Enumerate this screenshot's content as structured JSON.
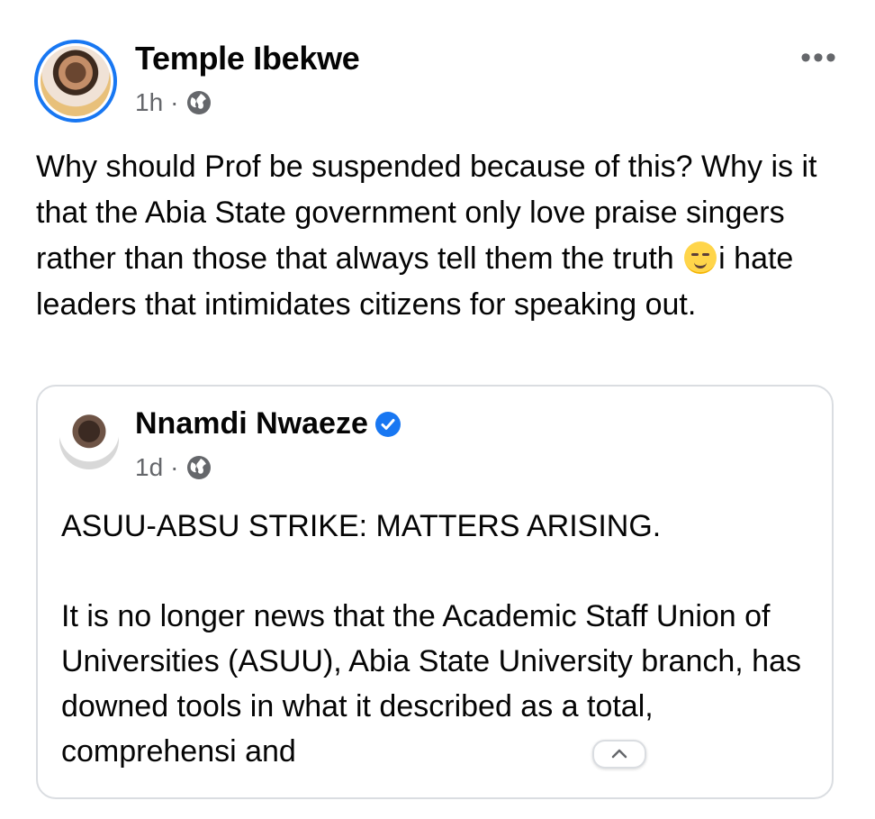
{
  "post": {
    "author_name": "Temple Ibekwe",
    "timestamp": "1h",
    "separator": "·",
    "visibility_icon": "globe-icon",
    "more_icon": "more-options-icon",
    "more_label": "•••",
    "text_part1": "Why should Prof be suspended because of this? Why is it that the Abia State government only love praise singers rather than those that always tell them the truth ",
    "emoji": "smirking-face-emoji",
    "text_part2": "i hate leaders that intimidates citizens for speaking out."
  },
  "shared_post": {
    "author_name": "Nnamdi Nwaeze",
    "verified_icon": "verified-badge-icon",
    "timestamp": "1d",
    "separator": "·",
    "visibility_icon": "globe-icon",
    "paragraphs": [
      "ASUU-ABSU STRIKE: MATTERS ARISING.",
      "It is no longer news that the Academic Staff Union of Universities (ASUU), Abia State University branch, has downed tools in what it described as a total, comprehensi and"
    ]
  },
  "scroll_chip": {
    "icon": "chevron-up-icon",
    "label": "^"
  },
  "colors": {
    "accent": "#1877f2",
    "meta_text": "#65676b",
    "card_border": "#dadde1"
  }
}
